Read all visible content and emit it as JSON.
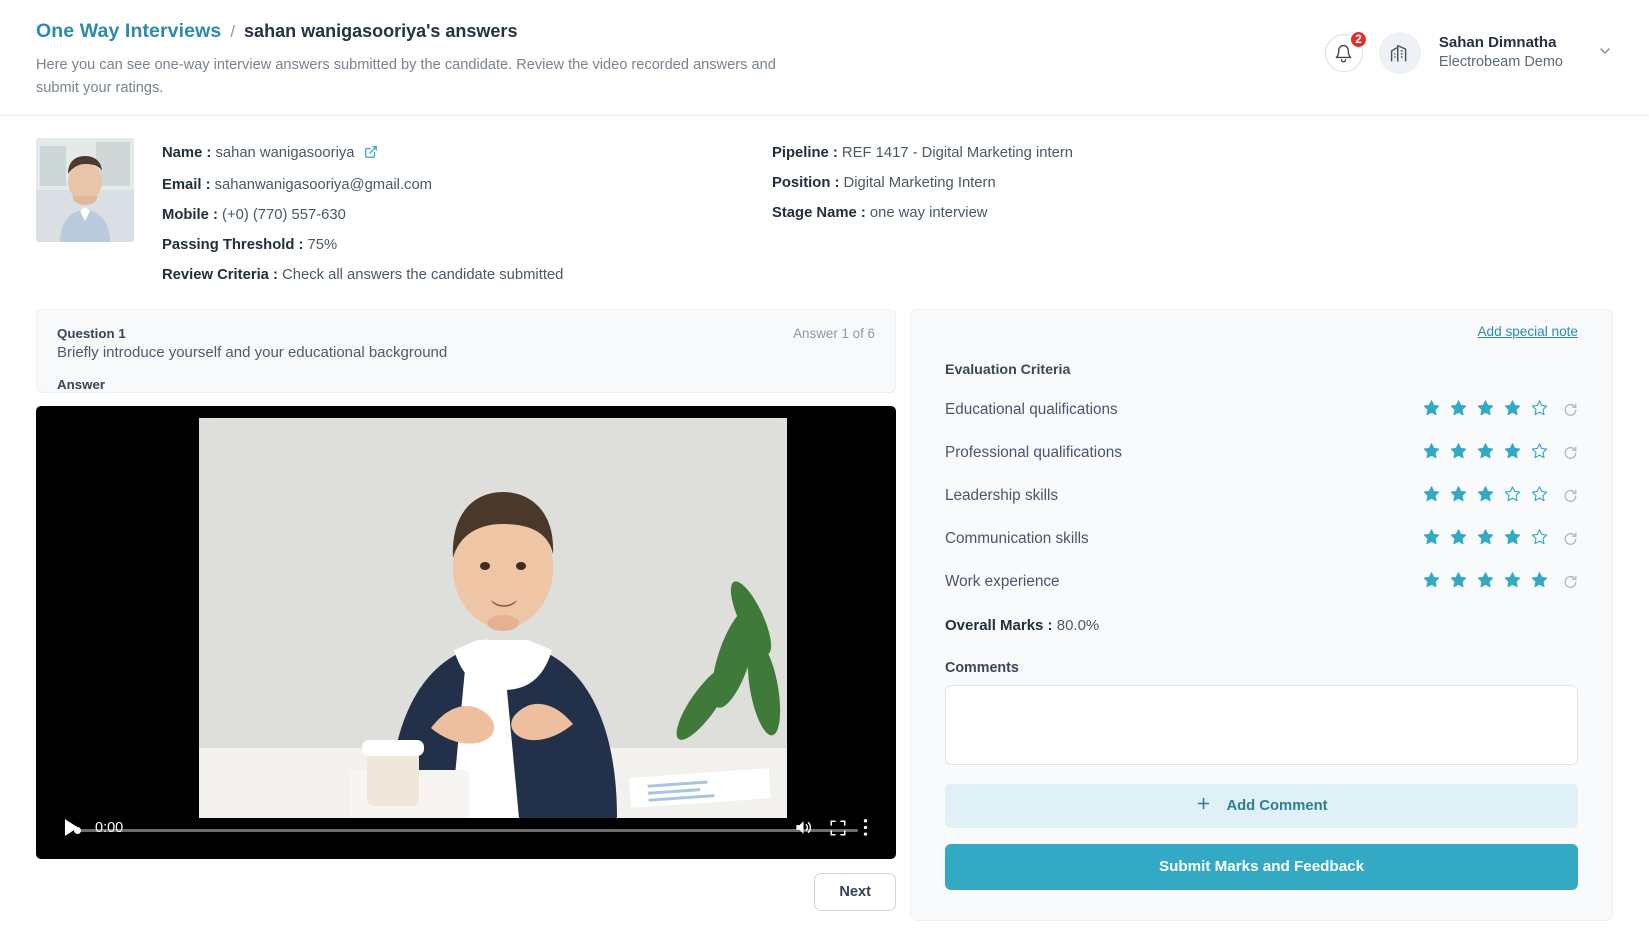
{
  "header": {
    "breadcrumb_root": "One Way Interviews",
    "breadcrumb_separator": "/",
    "breadcrumb_current": "sahan wanigasooriya's answers",
    "subtitle": "Here you can see one-way interview answers submitted by the candidate. Review the video recorded answers and submit your ratings.",
    "notification_count": "2",
    "user_name": "Sahan Dimnatha",
    "user_org": "Electrobeam Demo"
  },
  "candidate": {
    "name_label": "Name :",
    "name_value": "sahan wanigasooriya",
    "email_label": "Email :",
    "email_value": "sahanwanigasooriya@gmail.com",
    "mobile_label": "Mobile :",
    "mobile_value": "(+0) (770) 557-630",
    "threshold_label": "Passing Threshold :",
    "threshold_value": "75%",
    "criteria_label": "Review Criteria :",
    "criteria_value": "Check all answers the candidate submitted",
    "pipeline_label": "Pipeline :",
    "pipeline_value": "REF 1417 - Digital Marketing intern",
    "position_label": "Position :",
    "position_value": "Digital Marketing Intern",
    "stage_label": "Stage Name :",
    "stage_value": "one way interview"
  },
  "question": {
    "number": "Question 1",
    "text": "Briefly introduce yourself and your educational background",
    "counter": "Answer 1 of 6",
    "answer_label": "Answer"
  },
  "video": {
    "time": "0:00"
  },
  "navigation": {
    "next_label": "Next"
  },
  "evaluation": {
    "special_note_label": "Add special note",
    "title": "Evaluation Criteria",
    "criteria": [
      {
        "label": "Educational qualifications",
        "rating": 4,
        "max": 5
      },
      {
        "label": "Professional qualifications",
        "rating": 4,
        "max": 5
      },
      {
        "label": "Leadership skills",
        "rating": 3,
        "max": 5
      },
      {
        "label": "Communication skills",
        "rating": 4,
        "max": 5
      },
      {
        "label": "Work experience",
        "rating": 5,
        "max": 5
      }
    ],
    "overall_label": "Overall Marks :",
    "overall_value": "80.0%",
    "comments_label": "Comments",
    "comments_value": "",
    "comments_placeholder": "",
    "add_comment_label": "Add Comment",
    "submit_label": "Submit Marks and Feedback"
  },
  "colors": {
    "accent": "#34a9c4",
    "link": "#2c8ca8",
    "badge": "#e03131",
    "star_filled": "#34a9c4",
    "add_comment_bg": "#dff1f6"
  }
}
